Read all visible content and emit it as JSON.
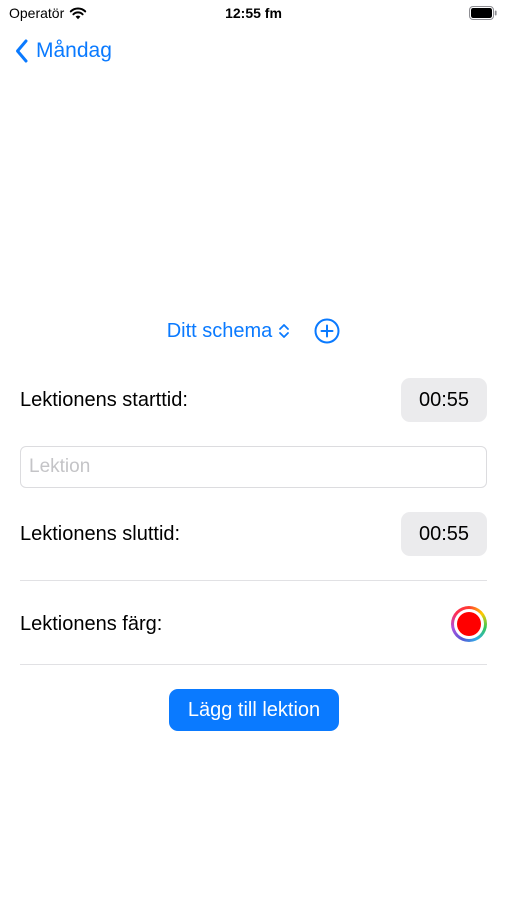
{
  "status_bar": {
    "carrier": "Operatör",
    "time": "12:55 fm",
    "icons": [
      "wifi-icon",
      "battery-icon"
    ]
  },
  "nav": {
    "back_label": "Måndag",
    "back_icon": "chevron-left-icon"
  },
  "schedule": {
    "label": "Ditt schema",
    "picker_icon": "updown-icon",
    "add_icon": "add-circle-icon"
  },
  "form": {
    "start_label": "Lektionens starttid:",
    "start_time": "00:55",
    "lesson_placeholder": "Lektion",
    "lesson_value": "",
    "end_label": "Lektionens sluttid:",
    "end_time": "00:55",
    "color_label": "Lektionens färg:",
    "color_value": "#ff0000",
    "submit_label": "Lägg till lektion"
  },
  "colors": {
    "accent": "#0a7aff",
    "pill_background": "#ebebed"
  }
}
